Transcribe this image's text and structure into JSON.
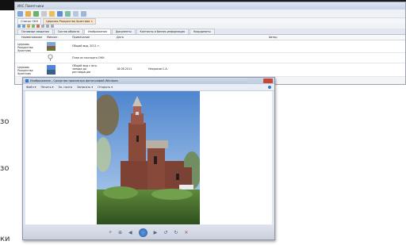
{
  "background": {
    "fragments": [
      "зо",
      "зо",
      "ки"
    ]
  },
  "app": {
    "title": "ИАС Памятники",
    "doc_tabs": [
      {
        "label": "Список ОКН"
      },
      {
        "label": "Церковь Рождества Христова"
      }
    ],
    "sub_tabs": [
      {
        "label": "Основные сведения"
      },
      {
        "label": "Состав объекта"
      },
      {
        "label": "Изображения"
      },
      {
        "label": "Документы"
      },
      {
        "label": "Контакты и бизнес-информация"
      },
      {
        "label": "Координаты"
      }
    ],
    "columns": [
      "Наименование",
      "Миниат.",
      "Примечание",
      "Дата",
      "Автор"
    ],
    "rows": [
      {
        "name": "Церковь Рождества Христова",
        "note": "Общий вид, 2011 г.",
        "date": "",
        "author": ""
      },
      {
        "name": "",
        "note": "План из паспорта ОКН",
        "date": "",
        "author": ""
      },
      {
        "name": "Церковь Рождества Христова",
        "note": "Общий вид с юго-запада до реставрации",
        "date": "18.08.2011",
        "author": "Некрасов С.А."
      }
    ]
  },
  "viewer": {
    "title": "Изображение - Средство просмотра фотографий Windows",
    "menu": [
      "Файл ▾",
      "Печать ▾",
      "Эл. почта",
      "Записать ▾",
      "Открыть ▾"
    ]
  },
  "colors": {
    "accent": "#3a78c2",
    "viewer_frame": "#dfe6f1",
    "sky": "#6f9fd8",
    "brick": "#8a4a3a"
  }
}
